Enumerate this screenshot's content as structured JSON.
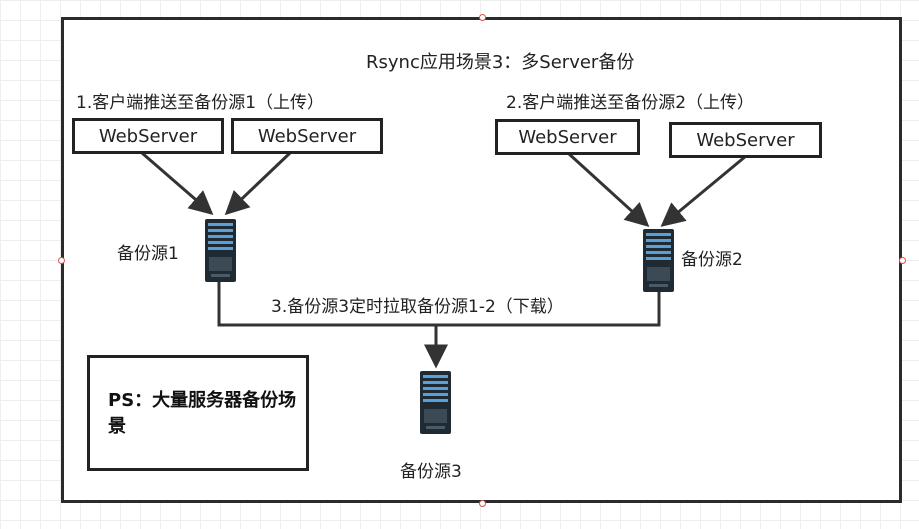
{
  "diagram": {
    "title": "Rsync应用场景3：多Server备份",
    "step1_label": "1.客户端推送至备份源1（上传）",
    "step2_label": "2.客户端推送至备份源2（上传）",
    "step3_label": "3.备份源3定时拉取备份源1-2（下载）",
    "web_servers": [
      {
        "label": "WebServer"
      },
      {
        "label": "WebServer"
      },
      {
        "label": "WebServer"
      },
      {
        "label": "WebServer"
      }
    ],
    "servers": [
      {
        "label": "备份源1",
        "icon": "server-rack-icon"
      },
      {
        "label": "备份源2",
        "icon": "server-rack-icon"
      },
      {
        "label": "备份源3",
        "icon": "server-rack-icon"
      }
    ],
    "note": "PS：大量服务器备份场景",
    "colors": {
      "line": "#333333",
      "server": "#1f2a33",
      "server_accent": "#5aa0d6",
      "handle": "#d9534f"
    }
  }
}
